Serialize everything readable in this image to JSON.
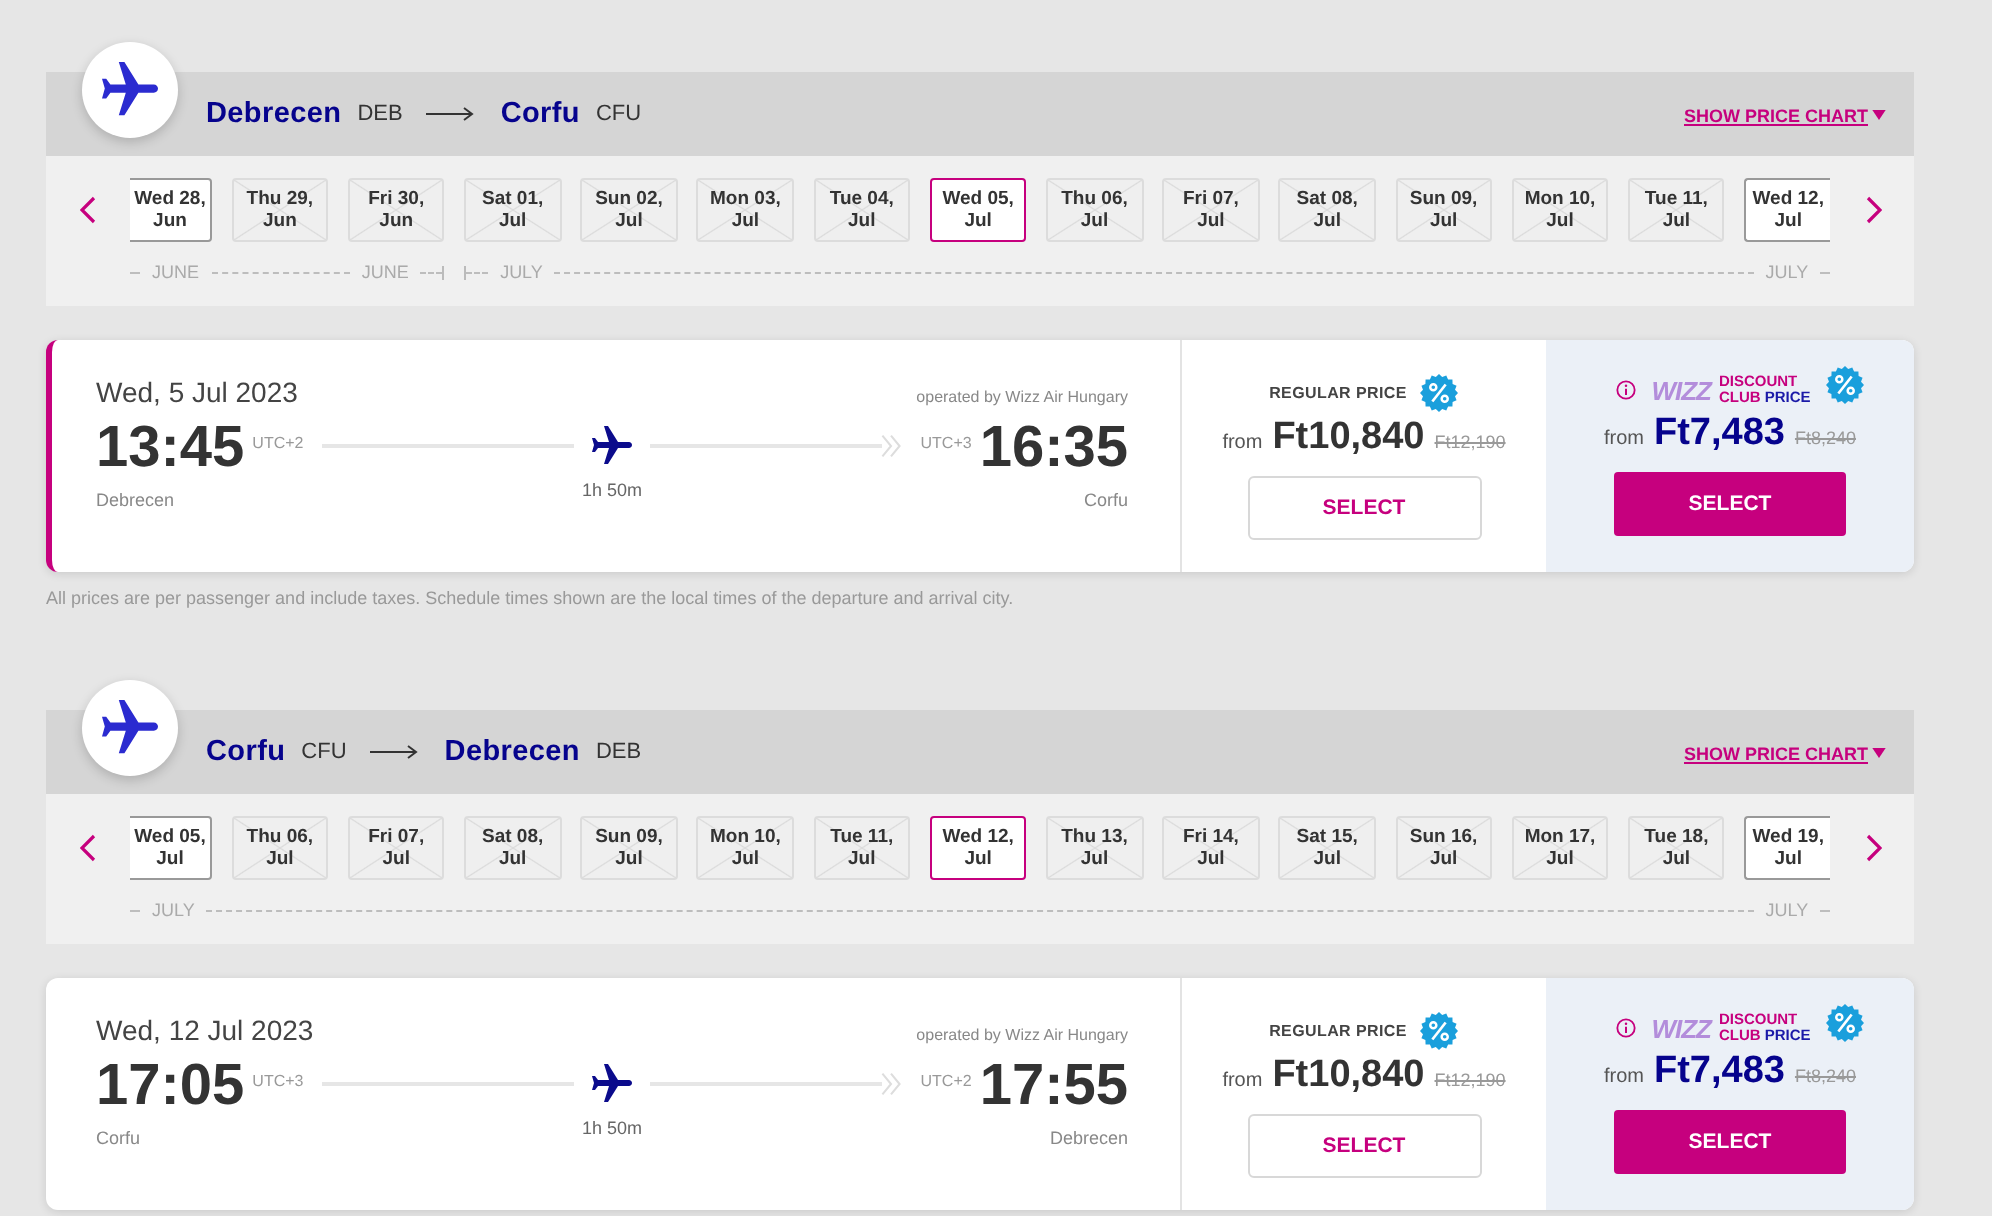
{
  "sections": [
    {
      "route": {
        "from_city": "Debrecen",
        "from_code": "DEB",
        "to_city": "Corfu",
        "to_code": "CFU"
      },
      "price_chart_link": "SHOW PRICE CHART",
      "months": [
        {
          "start_label": "JUNE",
          "end_label": "JUNE",
          "dates": [
            {
              "day": "Wed 28,",
              "month": "Jun",
              "available": true,
              "selected": false
            },
            {
              "day": "Thu 29,",
              "month": "Jun",
              "available": false,
              "selected": false
            },
            {
              "day": "Fri 30,",
              "month": "Jun",
              "available": false,
              "selected": false
            }
          ]
        },
        {
          "start_label": "JULY",
          "end_label": "JULY",
          "dates": [
            {
              "day": "Sat 01,",
              "month": "Jul",
              "available": false,
              "selected": false
            },
            {
              "day": "Sun 02,",
              "month": "Jul",
              "available": false,
              "selected": false
            },
            {
              "day": "Mon 03,",
              "month": "Jul",
              "available": false,
              "selected": false
            },
            {
              "day": "Tue 04,",
              "month": "Jul",
              "available": false,
              "selected": false
            },
            {
              "day": "Wed 05,",
              "month": "Jul",
              "available": true,
              "selected": true
            },
            {
              "day": "Thu 06,",
              "month": "Jul",
              "available": false,
              "selected": false
            },
            {
              "day": "Fri 07,",
              "month": "Jul",
              "available": false,
              "selected": false
            },
            {
              "day": "Sat 08,",
              "month": "Jul",
              "available": false,
              "selected": false
            },
            {
              "day": "Sun 09,",
              "month": "Jul",
              "available": false,
              "selected": false
            },
            {
              "day": "Mon 10,",
              "month": "Jul",
              "available": false,
              "selected": false
            },
            {
              "day": "Tue 11,",
              "month": "Jul",
              "available": false,
              "selected": false
            },
            {
              "day": "Wed 12,",
              "month": "Jul",
              "available": true,
              "selected": false
            }
          ]
        }
      ],
      "flight": {
        "selected": true,
        "date": "Wed, 5 Jul 2023",
        "operator": "operated by Wizz Air Hungary",
        "departure_time": "13:45",
        "departure_utc": "UTC+2",
        "departure_city": "Debrecen",
        "duration": "1h 50m",
        "arrival_utc": "UTC+3",
        "arrival_time": "16:35",
        "arrival_city": "Corfu",
        "regular": {
          "label": "REGULAR PRICE",
          "from": "from",
          "price": "Ft10,840",
          "old_price": "Ft12,190",
          "button": "SELECT"
        },
        "club": {
          "logo": "WIZZ",
          "label_top": "DISCOUNT",
          "label_club": "CLUB",
          "label_price": "PRICE",
          "from": "from",
          "price": "Ft7,483",
          "old_price": "Ft8,240",
          "button": "SELECT"
        }
      },
      "note": "All prices are per passenger and include taxes. Schedule times shown are the local times of the departure and arrival city."
    },
    {
      "route": {
        "from_city": "Corfu",
        "from_code": "CFU",
        "to_city": "Debrecen",
        "to_code": "DEB"
      },
      "price_chart_link": "SHOW PRICE CHART",
      "months": [
        {
          "start_label": "JULY",
          "end_label": "JULY",
          "dates": [
            {
              "day": "Wed 05,",
              "month": "Jul",
              "available": true,
              "selected": false
            },
            {
              "day": "Thu 06,",
              "month": "Jul",
              "available": false,
              "selected": false
            },
            {
              "day": "Fri 07,",
              "month": "Jul",
              "available": false,
              "selected": false
            },
            {
              "day": "Sat 08,",
              "month": "Jul",
              "available": false,
              "selected": false
            },
            {
              "day": "Sun 09,",
              "month": "Jul",
              "available": false,
              "selected": false
            },
            {
              "day": "Mon 10,",
              "month": "Jul",
              "available": false,
              "selected": false
            },
            {
              "day": "Tue 11,",
              "month": "Jul",
              "available": false,
              "selected": false
            },
            {
              "day": "Wed 12,",
              "month": "Jul",
              "available": true,
              "selected": true
            },
            {
              "day": "Thu 13,",
              "month": "Jul",
              "available": false,
              "selected": false
            },
            {
              "day": "Fri 14,",
              "month": "Jul",
              "available": false,
              "selected": false
            },
            {
              "day": "Sat 15,",
              "month": "Jul",
              "available": false,
              "selected": false
            },
            {
              "day": "Sun 16,",
              "month": "Jul",
              "available": false,
              "selected": false
            },
            {
              "day": "Mon 17,",
              "month": "Jul",
              "available": false,
              "selected": false
            },
            {
              "day": "Tue 18,",
              "month": "Jul",
              "available": false,
              "selected": false
            },
            {
              "day": "Wed 19,",
              "month": "Jul",
              "available": true,
              "selected": false
            }
          ]
        }
      ],
      "flight": {
        "selected": false,
        "date": "Wed, 12 Jul 2023",
        "operator": "operated by Wizz Air Hungary",
        "departure_time": "17:05",
        "departure_utc": "UTC+3",
        "departure_city": "Corfu",
        "duration": "1h 50m",
        "arrival_utc": "UTC+2",
        "arrival_time": "17:55",
        "arrival_city": "Debrecen",
        "regular": {
          "label": "REGULAR PRICE",
          "from": "from",
          "price": "Ft10,840",
          "old_price": "Ft12,190",
          "button": "SELECT"
        },
        "club": {
          "logo": "WIZZ",
          "label_top": "DISCOUNT",
          "label_club": "CLUB",
          "label_price": "PRICE",
          "from": "from",
          "price": "Ft7,483",
          "old_price": "Ft8,240",
          "button": "SELECT"
        }
      }
    }
  ]
}
